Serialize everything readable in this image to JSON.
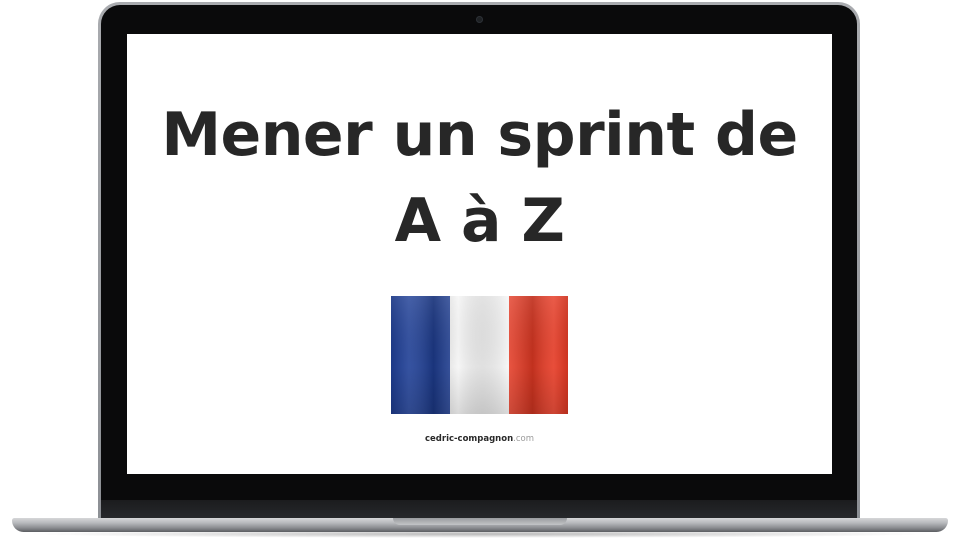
{
  "slide": {
    "title_line1": "Mener un sprint de",
    "title_line2": "A à Z",
    "footer_domain": "cedric-compagnon",
    "footer_tld": ".com"
  },
  "flag": {
    "icon": "french-flag-icon",
    "colors": {
      "blue": "#1f3f96",
      "white": "#f4f4f4",
      "red": "#e63a24"
    }
  },
  "device": {
    "bezel_color": "#0a0a0b",
    "frame_color": "#9a9ca0",
    "screen_bg": "#ffffff",
    "title_color": "#272727"
  }
}
